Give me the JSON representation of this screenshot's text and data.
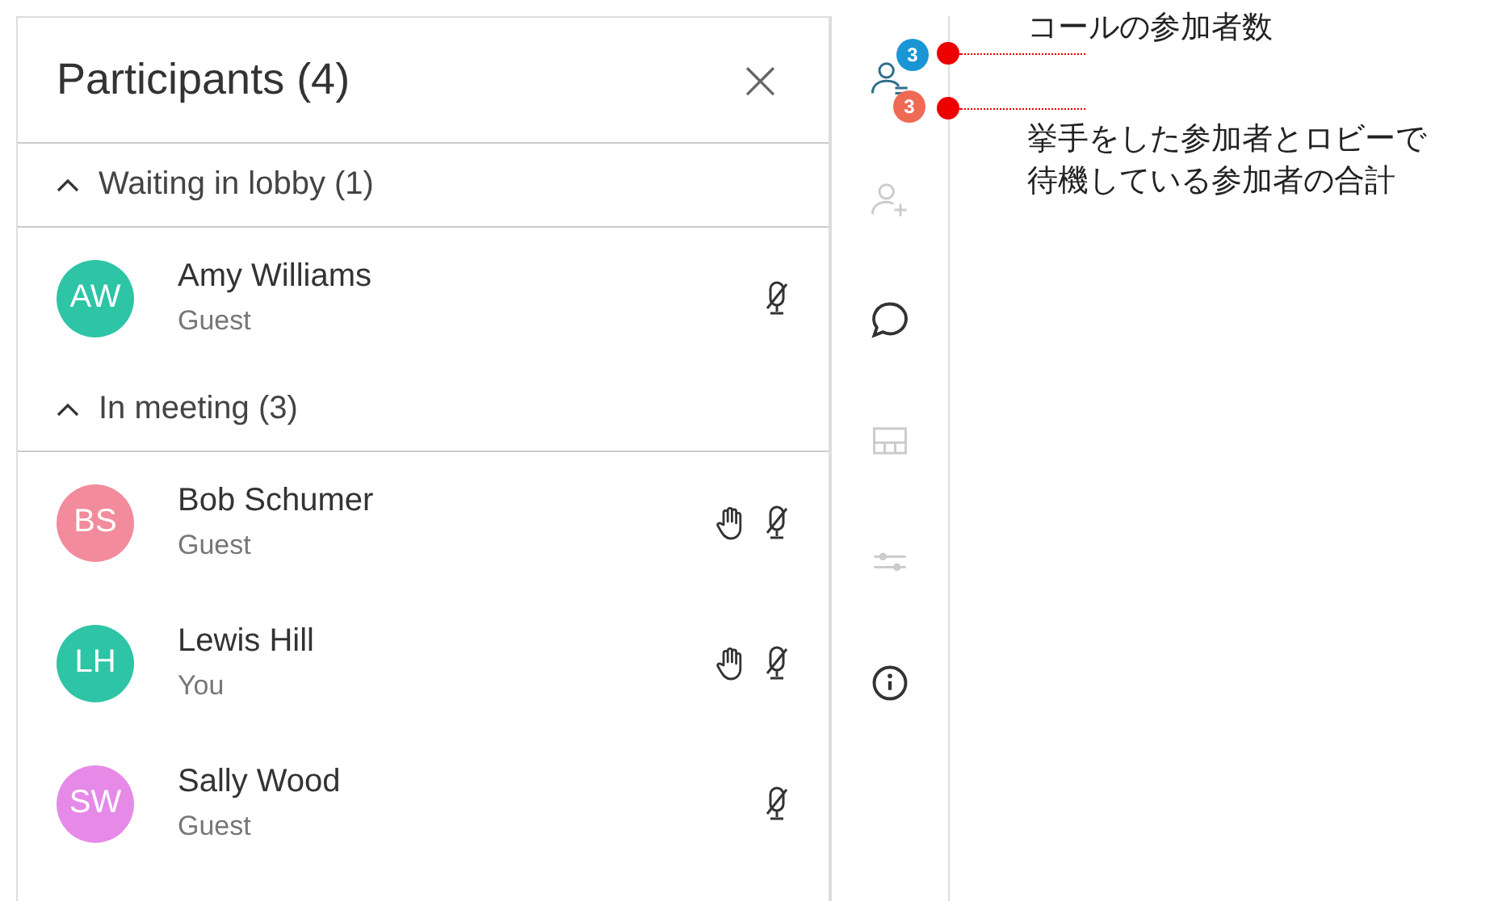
{
  "panel": {
    "title": "Participants (4)",
    "close": "×"
  },
  "sections": [
    {
      "label": "Waiting in lobby (1)",
      "expanded": true,
      "participants": [
        {
          "initials": "AW",
          "name": "Amy Williams",
          "role": "Guest",
          "color": "#2ec4a6",
          "hand_raised": false,
          "muted": true
        }
      ]
    },
    {
      "label": "In meeting (3)",
      "expanded": true,
      "participants": [
        {
          "initials": "BS",
          "name": "Bob Schumer",
          "role": "Guest",
          "color": "#f28b9c",
          "hand_raised": true,
          "muted": true
        },
        {
          "initials": "LH",
          "name": "Lewis Hill",
          "role": "You",
          "color": "#2ec4a6",
          "hand_raised": true,
          "muted": true
        },
        {
          "initials": "SW",
          "name": "Sally Wood",
          "role": "Guest",
          "color": "#e68ae8",
          "hand_raised": false,
          "muted": true
        }
      ]
    }
  ],
  "sidebar": {
    "items": [
      {
        "kind": "participants",
        "disabled": false,
        "selected": true
      },
      {
        "kind": "add-person",
        "disabled": true,
        "selected": false
      },
      {
        "kind": "chat",
        "disabled": false,
        "selected": false
      },
      {
        "kind": "layout",
        "disabled": true,
        "selected": false
      },
      {
        "kind": "sliders",
        "disabled": true,
        "selected": false
      },
      {
        "kind": "info",
        "disabled": false,
        "selected": false
      }
    ],
    "badges": [
      {
        "count": "3",
        "color": "#1a96d4"
      },
      {
        "count": "3",
        "color": "#ee6a55"
      }
    ]
  },
  "annotations": [
    {
      "text": "コールの参加者数"
    },
    {
      "text": "挙手をした参加者とロビーで待機している参加者の合計"
    }
  ]
}
